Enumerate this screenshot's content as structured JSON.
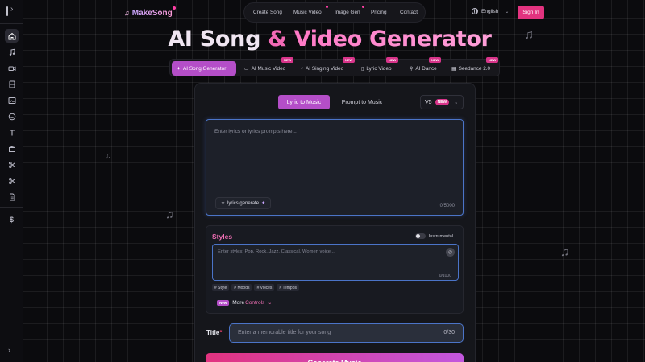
{
  "brand": {
    "logo_text": "MakeSong"
  },
  "topnav": {
    "items": [
      "Create Song",
      "Music Video",
      "Image Gen",
      "Pricing",
      "Contact"
    ]
  },
  "language": {
    "selected": "English"
  },
  "auth": {
    "signin_label": "Sign In"
  },
  "hero": {
    "part1": "AI Song",
    "amp": "&",
    "part2": "Video Generator"
  },
  "feature_tabs": [
    {
      "label": "AI Song Generator",
      "icon": "sparkle-icon",
      "is_new": false,
      "active": true
    },
    {
      "label": "AI Music Video",
      "icon": "video-icon",
      "is_new": true,
      "active": false
    },
    {
      "label": "AI Singing Video",
      "icon": "mic-icon",
      "is_new": true,
      "active": false
    },
    {
      "label": "Lyric Video",
      "icon": "document-icon",
      "is_new": true,
      "active": false
    },
    {
      "label": "AI Dance",
      "icon": "dance-icon",
      "is_new": true,
      "active": false
    },
    {
      "label": "Seedance 2.0",
      "icon": "calendar-icon",
      "is_new": true,
      "active": false
    }
  ],
  "new_badge": "NEW",
  "mode": {
    "lyric_to_music": "Lyric to Music",
    "prompt_to_music": "Prompt to Music",
    "active": "lyric_to_music"
  },
  "version": {
    "value": "V5",
    "badge": "NEW"
  },
  "lyrics": {
    "placeholder": "Enter lyrics or lyrics prompts here...",
    "generate_label": "lyrics generate",
    "count": "0/5000"
  },
  "styles": {
    "title": "Styles",
    "instrumental_label": "Instrumental",
    "instrumental_on": false,
    "placeholder": "Enter styles: Pop, Rock, Jazz, Classical, Women voice...",
    "count": "0/1000",
    "tags": [
      "# Style",
      "# Moods",
      "# Voices",
      "# Tempos"
    ],
    "more_badge": "New",
    "more_label_1": "More",
    "more_label_2": "Controls"
  },
  "title_field": {
    "label": "Title",
    "required_mark": "*",
    "placeholder": "Enter a memorable title for your song",
    "count": "0/30"
  },
  "generate": {
    "label": "Generate Music"
  },
  "colors": {
    "accent_pink": "#e2337f",
    "accent_purple": "#b44ec8",
    "focus_blue": "#4b74c8"
  },
  "sidebar": {
    "icons": [
      "home-icon",
      "music-note-icon",
      "video-camera-icon",
      "film-icon",
      "image-icon",
      "face-icon",
      "text-icon",
      "clapperboard-icon",
      "scissors-icon",
      "cut-icon",
      "document-icon",
      "dollar-icon"
    ]
  }
}
